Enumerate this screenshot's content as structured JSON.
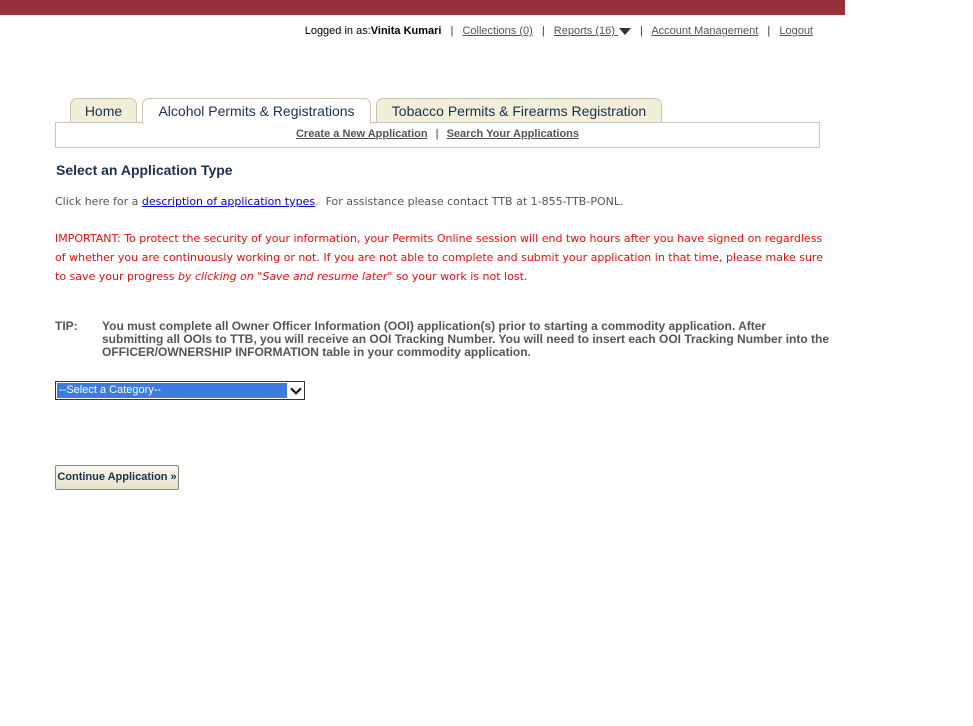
{
  "header": {
    "logged_in_label": "Logged in as:",
    "user_name": "Vinita Kumari",
    "links": {
      "collections": "Collections (0)",
      "reports": "Reports (16)",
      "account": "Account Management",
      "logout": "Logout"
    },
    "separator": "|",
    "brand_color": "#96303a"
  },
  "tabs": [
    {
      "label": "Home",
      "active": false
    },
    {
      "label": "Alcohol Permits & Registrations",
      "active": true
    },
    {
      "label": "Tobacco Permits & Firearms Registration",
      "active": false
    }
  ],
  "subnav": {
    "create": "Create a New Application",
    "search": "Search Your Applications",
    "separator": "|"
  },
  "main": {
    "heading": "Select an Application Type",
    "desc_prefix": "Click here for a",
    "desc_link": "description of application types",
    "desc_suffix": ".  For assistance please contact TTB at 1-855-TTB-PONL.",
    "important_text": "IMPORTANT: To protect the security of your information, your Permits Online session will end two hours after you have signed on regardless of whether you are continuously working or not. If you are not able to complete and submit your application in that time, please make sure to save your progress ",
    "important_italic": "by clicking on \"Save and resume later\"",
    "important_tail": " so your work is not lost.",
    "tip_label": "TIP:",
    "tip_text": "You must complete all Owner Officer Information (OOI) application(s) prior to starting a commodity application.  After submitting all OOIs to TTB, you will receive an OOI Tracking Number.  You will need to insert each OOI Tracking Number into the OFFICER/OWNERSHIP INFORMATION table in your commodity application.",
    "category_select": "--Select a Category--",
    "continue_button": "Continue Application »"
  },
  "colors": {
    "important": "#e01010",
    "heading": "#1b2f52",
    "select_highlight": "#3a7ce0"
  }
}
